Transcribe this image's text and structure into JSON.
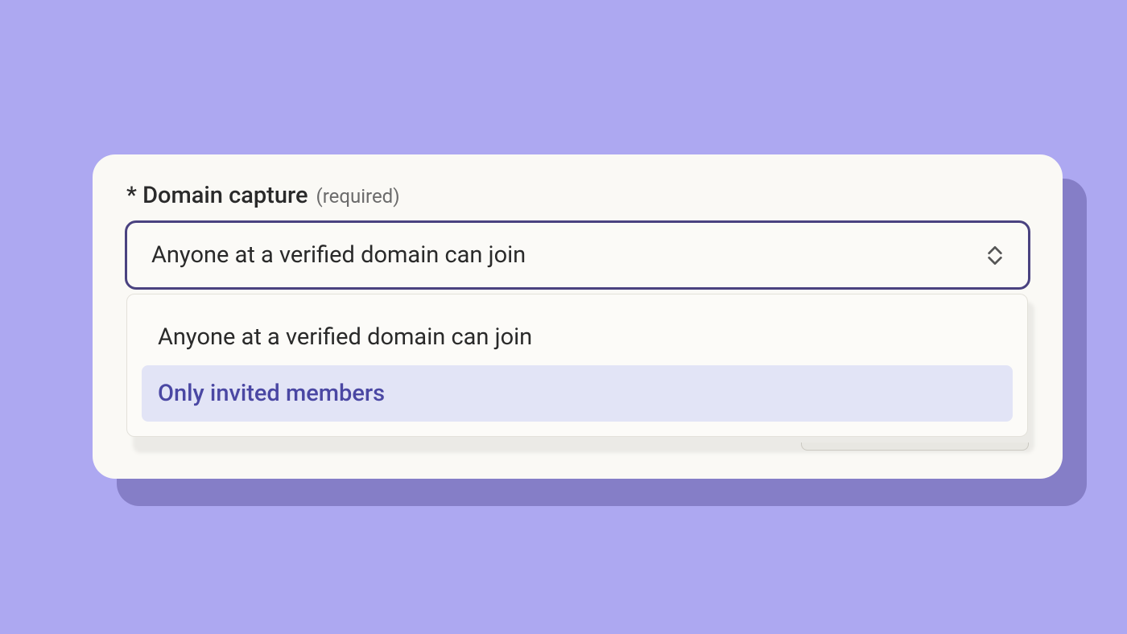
{
  "field": {
    "asterisk": "*",
    "label": "Domain capture",
    "hint": "(required)",
    "selected_value": "Anyone at a verified domain can join"
  },
  "options": [
    {
      "label": "Anyone at a verified domain can join",
      "highlighted": false
    },
    {
      "label": "Only invited members",
      "highlighted": true
    }
  ]
}
